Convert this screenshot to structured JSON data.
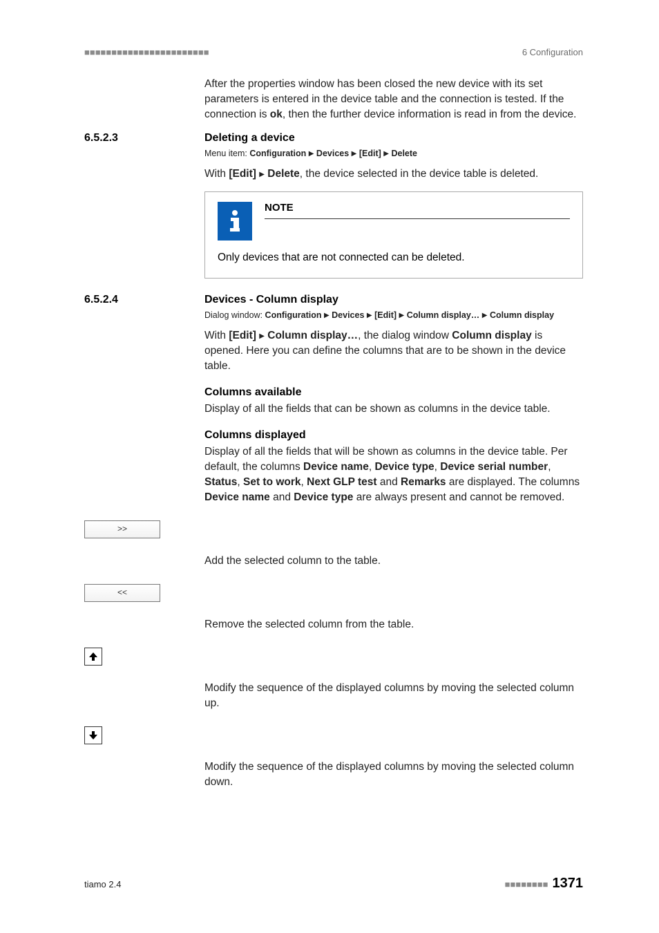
{
  "header": {
    "left": "■■■■■■■■■■■■■■■■■■■■■■■",
    "right": "6 Configuration"
  },
  "intro": {
    "p1a": "After the properties window has been closed the new device with its set parameters is entered in the device table and the connection is tested. If the connection is ",
    "ok": "ok",
    "p1b": ", then the further device information is read in from the device."
  },
  "s623": {
    "num": "6.5.2.3",
    "title": "Deleting a device",
    "menu_label": "Menu item: ",
    "menu_conf": "Configuration",
    "menu_dev": "Devices",
    "menu_edit": "[Edit]",
    "menu_del": "Delete",
    "with": "With ",
    "edit": "[Edit]",
    "delete": "Delete",
    "rest": ", the device selected in the device table is deleted.",
    "note_title": "NOTE",
    "note_body": "Only devices that are not connected can be deleted."
  },
  "s624": {
    "num": "6.5.2.4",
    "title": "Devices - Column display",
    "menu_label": "Dialog window: ",
    "menu_conf": "Configuration",
    "menu_dev": "Devices",
    "menu_edit": "[Edit]",
    "menu_coldisp": "Column display…",
    "menu_coldispplain": "Column display",
    "with": "With ",
    "edit": "[Edit]",
    "coldisp": "Column display…",
    "mid": ", the dialog window ",
    "coldispplain": "Column display",
    "rest": " is opened. Here you can define the columns that are to be shown in the device table.",
    "avail_h": "Columns available",
    "avail_p": "Display of all the fields that can be shown as columns in the device table.",
    "disp_h": "Columns displayed",
    "disp_p1": "Display of all the fields that will be shown as columns in the device table. Per default, the columns ",
    "c1": "Device name",
    "c2": "Device type",
    "c3": "Device serial number",
    "c4": "Status",
    "c5": "Set to work",
    "c6": "Next GLP test",
    "c7": "Remarks",
    "disp_p2": " are displayed. The columns ",
    "disp_p3": " and ",
    "disp_p4": " are always present and cannot be removed.",
    "btn_add": ">>",
    "add_desc": "Add the selected column to the table.",
    "btn_rem": "<<",
    "rem_desc": "Remove the selected column from the table.",
    "up_desc": "Modify the sequence of the displayed columns by moving the selected column up.",
    "down_desc": "Modify the sequence of the displayed columns by moving the selected column down."
  },
  "footer": {
    "left": "tiamo 2.4",
    "dots": "■■■■■■■■",
    "page": "1371"
  }
}
